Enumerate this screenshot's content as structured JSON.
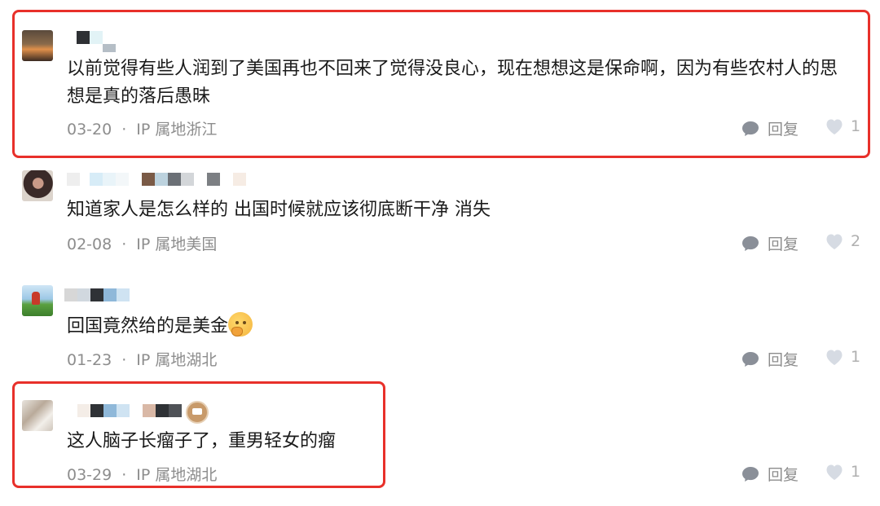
{
  "comments": [
    {
      "text": "以前觉得有些人润到了美国再也不回来了觉得没良心，现在想想这是保命啊，因为有些农村人的思想是真的落后愚昧",
      "date": "03-20",
      "location": "IP 属地浙江",
      "reply_label": "回复",
      "likes": "1",
      "highlighted": true
    },
    {
      "text": "知道家人是怎么样的 出国时候就应该彻底断干净 消失",
      "date": "02-08",
      "location": "IP 属地美国",
      "reply_label": "回复",
      "likes": "2",
      "highlighted": false
    },
    {
      "text": "回国竟然给的是美金",
      "emoji": "thinking-face",
      "date": "01-23",
      "location": "IP 属地湖北",
      "reply_label": "回复",
      "likes": "1",
      "highlighted": false
    },
    {
      "text": "这人脑子长瘤子了，重男轻女的瘤",
      "date": "03-29",
      "location": "IP 属地湖北",
      "reply_label": "回复",
      "likes": "1",
      "highlighted": true,
      "has_badge": true
    }
  ],
  "meta_separator": "·",
  "colors": {
    "highlight_border": "#e8302a",
    "meta_text": "#8d8d8d",
    "body_text": "#1a1a1a"
  },
  "icons": {
    "reply": "speech-bubble-icon",
    "like": "heart-icon",
    "badge": "crown-badge-icon"
  },
  "redacted_usernames": true
}
